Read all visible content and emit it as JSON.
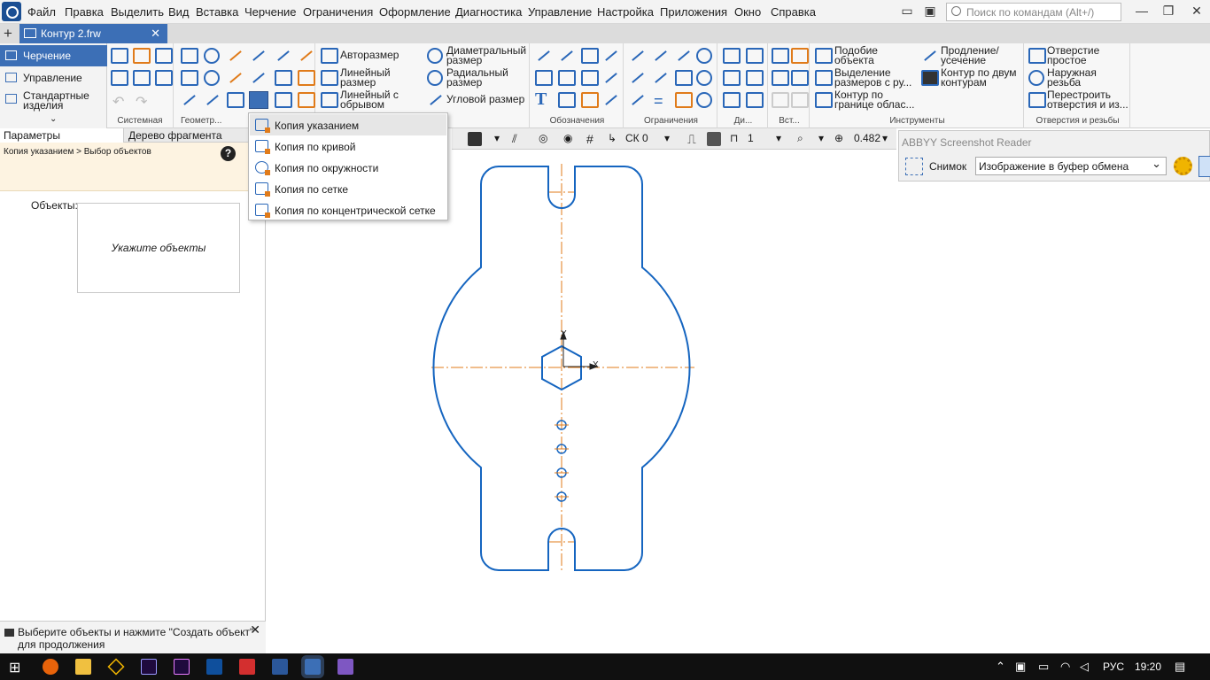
{
  "menubar": {
    "items": [
      "Файл",
      "Правка",
      "Выделить",
      "Вид",
      "Вставка",
      "Черчение",
      "Ограничения",
      "Оформление",
      "Диагностика",
      "Управление",
      "Настройка",
      "Приложения",
      "Окно",
      "Справка"
    ],
    "search_placeholder": "Поиск по командам (Alt+/)"
  },
  "document_tab": {
    "title": "Контур 2.frw",
    "close": "✕"
  },
  "leftnav": {
    "items": [
      "Черчение",
      "Управление",
      "Стандартные изделия"
    ]
  },
  "ribbon": {
    "groups": [
      "Системная",
      "Геометр...",
      "Обозначения",
      "Ограничения",
      "Ди...",
      "Вст...",
      "Инструменты",
      "Отверстия и резьбы"
    ],
    "dimension_buttons": [
      "Авторазмер",
      "Линейный размер",
      "Линейный с обрывом",
      "Диаметральный размер",
      "Радиальный размер",
      "Угловой размер"
    ],
    "tool_buttons": [
      "Подобие объекта",
      "Выделение размеров с ру...",
      "Контур по границе облас...",
      "Продление/ усечение",
      "Контур по двум контурам"
    ],
    "hole_buttons": [
      "Отверстие простое",
      "Наружная резьба",
      "Перестроить отверстия и из..."
    ]
  },
  "copy_menu": {
    "items": [
      "Копия указанием",
      "Копия по кривой",
      "Копия по окружности",
      "Копия по сетке",
      "Копия по концентрической сетке"
    ]
  },
  "panel": {
    "tabs": [
      "Параметры",
      "Дерево фрагмента"
    ],
    "breadcrumb": "Копия указанием > Выбор объектов",
    "help": "?",
    "objects_label": "Объекты:",
    "objects_placeholder": "Укажите объекты",
    "status": "Выберите объекты и нажмите \"Создать объект\" для продолжения",
    "status_close": "✕"
  },
  "canvas_toolbar": {
    "cs": "СК 0",
    "step": "1",
    "zoom": "0.482"
  },
  "axes": {
    "x": "X",
    "y": "Y"
  },
  "abbyy": {
    "title": "ABBYY Screenshot Reader",
    "label": "Снимок",
    "mode": "Изображение в буфер обмена"
  },
  "taskbar": {
    "lang": "РУС",
    "time": "19:20"
  },
  "colors": {
    "accent": "#3c6fb6",
    "contour": "#1565c0",
    "axis": "#e07b1a",
    "menu_highlight": "#e6e6e6"
  }
}
